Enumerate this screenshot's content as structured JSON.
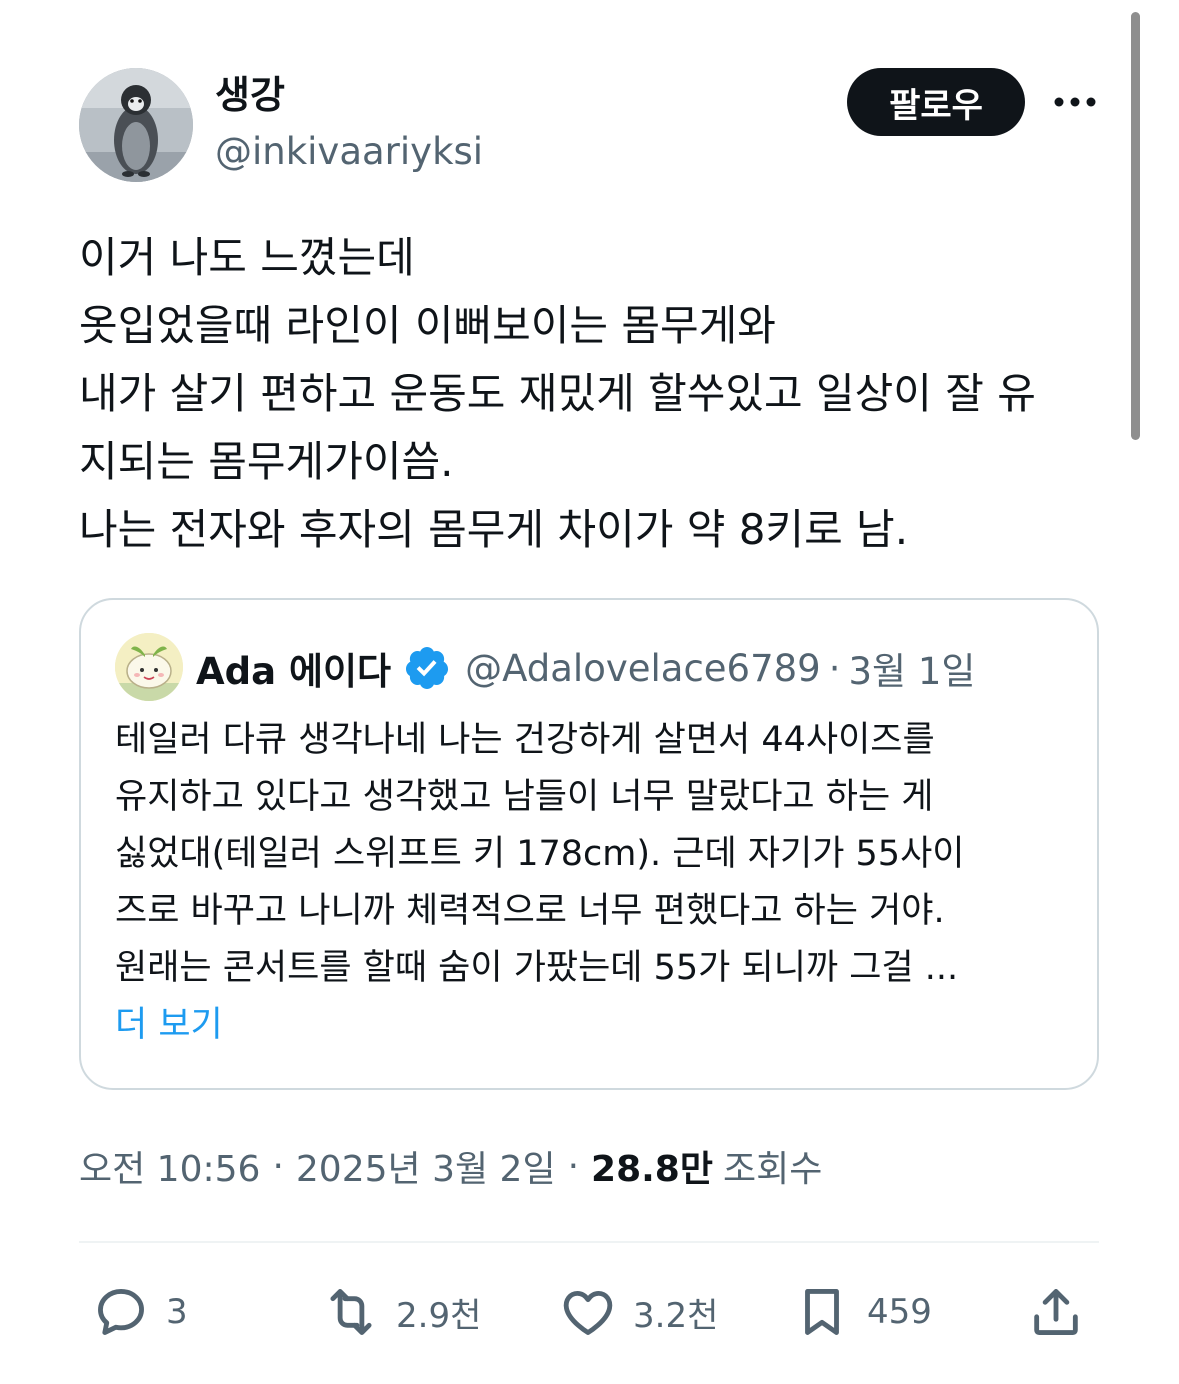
{
  "author": {
    "display_name": "생강",
    "handle": "@inkivaariyksi"
  },
  "follow_label": "팔로우",
  "more_icon": "more-dots-icon",
  "post_lines": [
    "이거 나도 느꼈는데",
    "옷입었을때 라인이 이뻐보이는 몸무게와",
    "내가 살기 편하고 운동도 재밌게 할쑤있고 일상이 잘 유",
    "지되는 몸무게가이씀.",
    "나는 전자와 후자의 몸무게 차이가 약 8키로 남."
  ],
  "quote": {
    "display_name": "Ada 에이다",
    "verified": true,
    "handle": "@Adalovelace6789",
    "separator": "·",
    "date": "3월 1일",
    "lines": [
      "테일러 다큐 생각나네 나는 건강하게 살면서 44사이즈를",
      "유지하고 있다고 생각했고 남들이 너무 말랐다고 하는 게",
      "싫었대(테일러 스위프트 키 178cm). 근데 자기가 55사이",
      "즈로 바꾸고 나니까 체력적으로 너무 편했다고 하는 거야.",
      "원래는 콘서트를 할때 숨이 가팠는데 55가 되니까 그걸 ..."
    ],
    "show_more": "더 보기"
  },
  "meta": {
    "time": "오전 10:56",
    "separator": "·",
    "date": "2025년 3월 2일",
    "views_count": "28.8만",
    "views_label": "조회수"
  },
  "actions": {
    "replies": "3",
    "reposts": "2.9천",
    "likes": "3.2천",
    "bookmarks": "459"
  },
  "colors": {
    "text": "#0f1419",
    "secondary": "#536471",
    "accent": "#1d9bf0",
    "border": "#cfd9de",
    "follow_bg": "#0f1419"
  }
}
